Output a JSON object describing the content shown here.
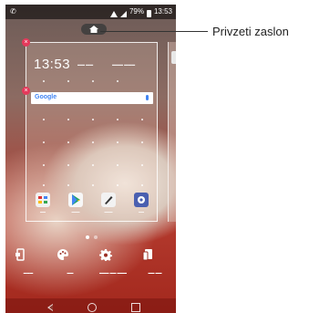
{
  "status_bar": {
    "left_glyph": "✆",
    "battery": "79%",
    "time": "13:53"
  },
  "widgets": {
    "clock_time": "13:53"
  },
  "search": {
    "logo_text": "Google"
  },
  "annotation": {
    "label": "Privzeti zaslon"
  },
  "icons": {
    "home_pill": "home-icon",
    "widgets": "widgets-icon",
    "theme": "palette-icon",
    "settings": "gear-icon",
    "apps": "apps-sort-icon"
  },
  "colors": {
    "accent_red": "#b33a2e",
    "remove_badge": "#e5395b",
    "google_blue": "#4285f4"
  }
}
